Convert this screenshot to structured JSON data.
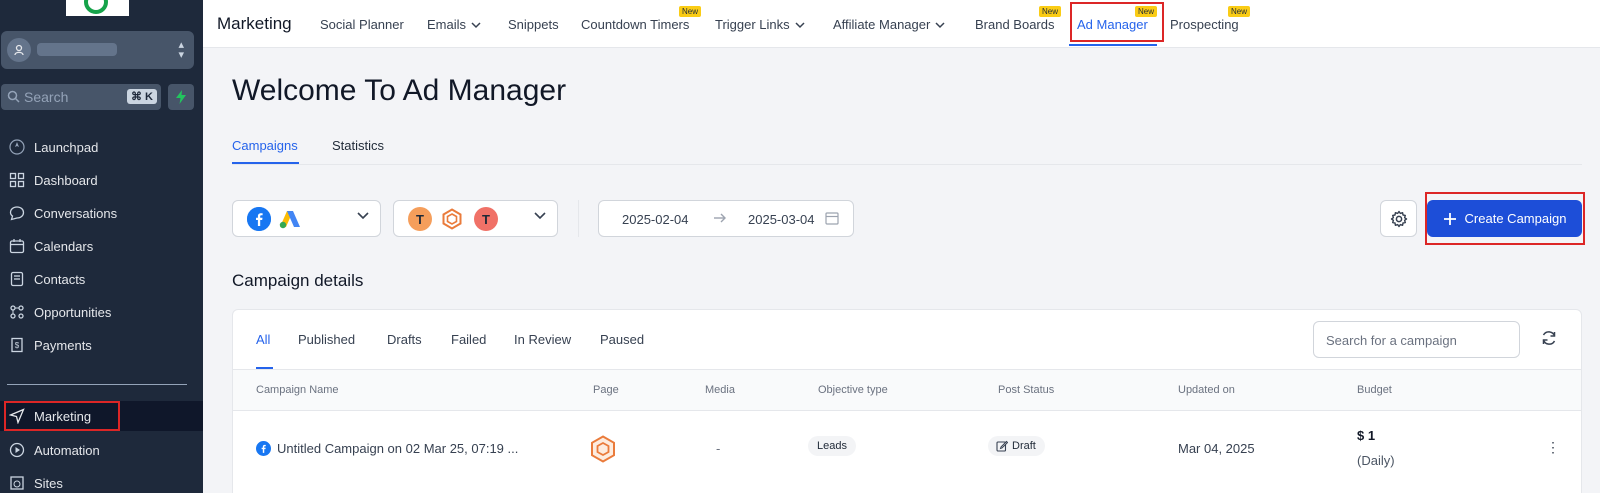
{
  "sidebar": {
    "search_placeholder": "Search",
    "search_shortcut": "⌘ K",
    "items": [
      {
        "label": "Launchpad",
        "icon": "rocket-icon"
      },
      {
        "label": "Dashboard",
        "icon": "grid-icon"
      },
      {
        "label": "Conversations",
        "icon": "chat-icon"
      },
      {
        "label": "Calendars",
        "icon": "calendar-icon"
      },
      {
        "label": "Contacts",
        "icon": "contacts-icon"
      },
      {
        "label": "Opportunities",
        "icon": "funnel-icon"
      },
      {
        "label": "Payments",
        "icon": "receipt-icon"
      },
      {
        "label": "Marketing",
        "icon": "send-icon"
      },
      {
        "label": "Automation",
        "icon": "play-circle-icon"
      },
      {
        "label": "Sites",
        "icon": "globe-icon"
      }
    ]
  },
  "topbar": {
    "title": "Marketing",
    "tabs": [
      {
        "label": "Social Planner"
      },
      {
        "label": "Emails"
      },
      {
        "label": "Snippets"
      },
      {
        "label": "Countdown Timers"
      },
      {
        "label": "Trigger Links"
      },
      {
        "label": "Affiliate Manager"
      },
      {
        "label": "Brand Boards"
      },
      {
        "label": "Ad Manager"
      },
      {
        "label": "Prospecting"
      }
    ],
    "new_badge": "New"
  },
  "main": {
    "title": "Welcome To Ad Manager",
    "subtabs": [
      "Campaigns",
      "Statistics"
    ],
    "date_from": "2025-02-04",
    "date_to": "2025-03-04",
    "create_button": "Create Campaign",
    "section_title": "Campaign details",
    "account_initial_1": "T",
    "account_initial_2": "T"
  },
  "campaigns": {
    "tabs": [
      "All",
      "Published",
      "Drafts",
      "Failed",
      "In Review",
      "Paused"
    ],
    "search_placeholder": "Search for a campaign",
    "columns": [
      "Campaign Name",
      "Page",
      "Media",
      "Objective type",
      "Post Status",
      "Updated on",
      "Budget"
    ],
    "rows": [
      {
        "name": "Untitled Campaign on 02 Mar 25, 07:19 ...",
        "media": "-",
        "objective": "Leads",
        "status": "Draft",
        "updated": "Mar 04, 2025",
        "budget": "$ 1",
        "budget_period": "(Daily)"
      }
    ]
  },
  "colors": {
    "sidebar_bg": "#1e293b",
    "accent": "#2563eb",
    "badge": "#facc15",
    "highlight": "#dc2626"
  }
}
